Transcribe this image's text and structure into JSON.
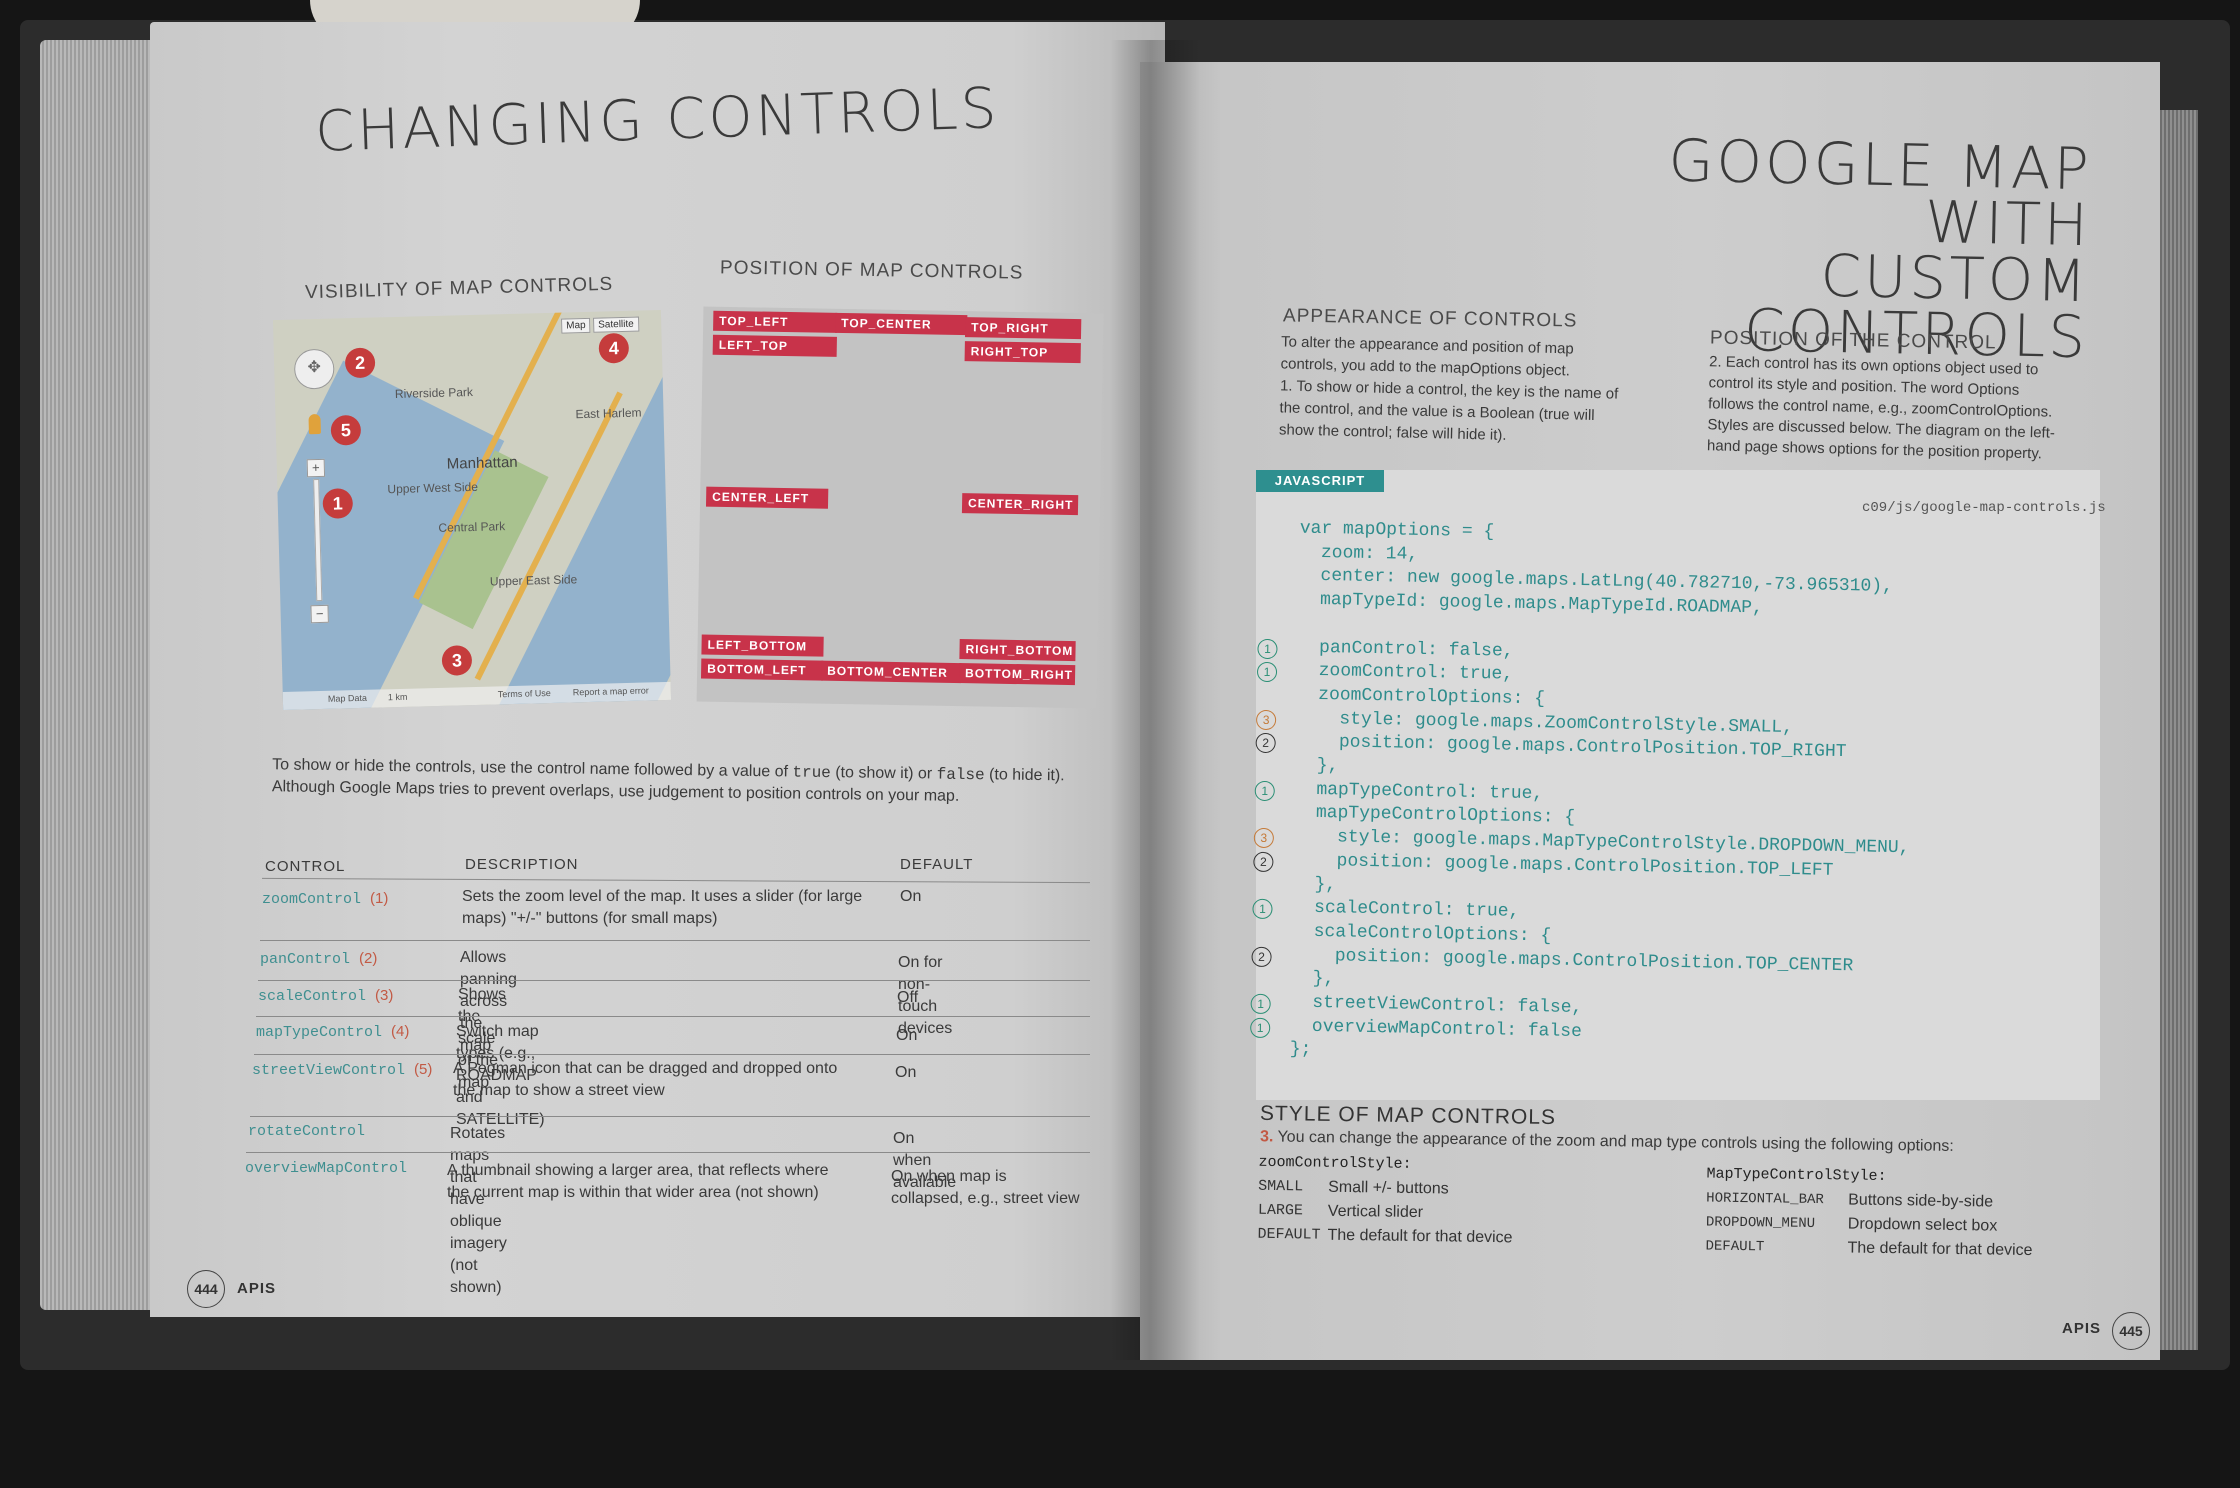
{
  "left_page": {
    "title": "CHANGING CONTROLS",
    "visibility_heading": "VISIBILITY OF MAP CONTROLS",
    "position_heading": "POSITION OF MAP CONTROLS",
    "map": {
      "type_buttons": [
        "Map",
        "Satellite"
      ],
      "place_labels": [
        "Manhattan",
        "Central Park",
        "Upper West Side",
        "Upper East Side",
        "Riverside Park",
        "East Harlem"
      ],
      "footer_labels": [
        "Map Data",
        "1 km",
        "Terms of Use",
        "Report a map error"
      ],
      "pins": [
        "1",
        "2",
        "3",
        "4",
        "5"
      ]
    },
    "positions": {
      "top_left": "TOP_LEFT",
      "top_center": "TOP_CENTER",
      "top_right": "TOP_RIGHT",
      "left_top": "LEFT_TOP",
      "right_top": "RIGHT_TOP",
      "center_left": "CENTER_LEFT",
      "center_right": "CENTER_RIGHT",
      "left_bottom": "LEFT_BOTTOM",
      "right_bottom": "RIGHT_BOTTOM",
      "bottom_left": "BOTTOM_LEFT",
      "bottom_center": "BOTTOM_CENTER",
      "bottom_right": "BOTTOM_RIGHT"
    },
    "intro": {
      "a": "To show or hide the controls, use the control name followed by a value of ",
      "true_kw": "true",
      "b": " (to show it) or ",
      "false_kw": "false",
      "c": " (to hide it).",
      "line2": "Although Google Maps tries to prevent overlaps, use judgement to position controls on your map."
    },
    "table": {
      "headers": [
        "CONTROL",
        "DESCRIPTION",
        "DEFAULT"
      ],
      "rows": [
        {
          "control": "zoomControl",
          "num": "(1)",
          "desc1": "Sets the zoom level of the map. It uses a slider (for large",
          "desc2": "maps) \"+/-\" buttons (for small maps)",
          "default1": "On",
          "default2": ""
        },
        {
          "control": "panControl",
          "num": "(2)",
          "desc1": "Allows panning across the map",
          "desc2": "",
          "default1": "On for non-touch devices",
          "default2": ""
        },
        {
          "control": "scaleControl",
          "num": "(3)",
          "desc1": "Shows the scale of the map",
          "desc2": "",
          "default1": "Off",
          "default2": ""
        },
        {
          "control": "mapTypeControl",
          "num": "(4)",
          "desc1": "Switch map types (e.g., ROADMAP and SATELLITE)",
          "desc2": "",
          "default1": "On",
          "default2": ""
        },
        {
          "control": "streetViewControl",
          "num": "(5)",
          "desc1": "A Pegman icon that can be dragged and dropped onto",
          "desc2": "the map to show a street view",
          "default1": "On",
          "default2": ""
        },
        {
          "control": "rotateControl",
          "num": "",
          "desc1": "Rotates maps that have oblique imagery (not shown)",
          "desc2": "",
          "default1": "On when available",
          "default2": ""
        },
        {
          "control": "overviewMapControl",
          "num": "",
          "desc1": "A thumbnail showing a larger area, that reflects where",
          "desc2": "the current map is within that wider area (not shown)",
          "default1": "On when map is",
          "default2": "collapsed, e.g., street view"
        }
      ]
    },
    "page_number": "444",
    "footer": "APIS"
  },
  "right_page": {
    "title_line1": "GOOGLE MAP WITH",
    "title_line2": "CUSTOM CONTROLS",
    "appearance_heading": "APPEARANCE OF CONTROLS",
    "appearance_text": [
      "To alter the appearance and position of map",
      "controls, you add to the mapOptions object.",
      "1. To show or hide a control, the key is the name of",
      "the control, and the value is a Boolean (true will",
      "show the control; false will hide it)."
    ],
    "position_heading": "POSITION OF THE CONTROL",
    "position_text": [
      "2. Each control has its own options object used to",
      "control its style and position. The word Options",
      "follows the control name, e.g., zoomControlOptions.",
      "Styles are discussed below. The  diagram on the left-",
      "hand page shows options for the position property."
    ],
    "js_label": "JAVASCRIPT",
    "file_path": "c09/js/google-map-controls.js",
    "code_lines": [
      {
        "text": "var mapOptions = {",
        "marker": ""
      },
      {
        "text": "  zoom: 14,",
        "marker": ""
      },
      {
        "text": "  center: new google.maps.LatLng(40.782710,-73.965310),",
        "marker": ""
      },
      {
        "text": "  mapTypeId: google.maps.MapTypeId.ROADMAP,",
        "marker": ""
      },
      {
        "text": "",
        "marker": ""
      },
      {
        "text": "  panControl: false,",
        "marker": "1"
      },
      {
        "text": "  zoomControl: true,",
        "marker": "1"
      },
      {
        "text": "  zoomControlOptions: {",
        "marker": ""
      },
      {
        "text": "    style: google.maps.ZoomControlStyle.SMALL,",
        "marker": "3"
      },
      {
        "text": "    position: google.maps.ControlPosition.TOP_RIGHT",
        "marker": "2"
      },
      {
        "text": "  },",
        "marker": ""
      },
      {
        "text": "  mapTypeControl: true,",
        "marker": "1"
      },
      {
        "text": "  mapTypeControlOptions: {",
        "marker": ""
      },
      {
        "text": "    style: google.maps.MapTypeControlStyle.DROPDOWN_MENU,",
        "marker": "3"
      },
      {
        "text": "    position: google.maps.ControlPosition.TOP_LEFT",
        "marker": "2"
      },
      {
        "text": "  },",
        "marker": ""
      },
      {
        "text": "  scaleControl: true,",
        "marker": "1"
      },
      {
        "text": "  scaleControlOptions: {",
        "marker": ""
      },
      {
        "text": "    position: google.maps.ControlPosition.TOP_CENTER",
        "marker": "2"
      },
      {
        "text": "  },",
        "marker": ""
      },
      {
        "text": "  streetViewControl: false,",
        "marker": "1"
      },
      {
        "text": "  overviewMapControl: false",
        "marker": "1"
      },
      {
        "text": "};",
        "marker": ""
      }
    ],
    "style_heading": "STYLE OF MAP CONTROLS",
    "style_intro_num": "3.",
    "style_intro": "You can change the appearance of the zoom and map type controls using the following options:",
    "zoom_style": {
      "heading": "zoomControlStyle:",
      "rows": [
        {
          "key": "SMALL",
          "value": "Small +/- buttons"
        },
        {
          "key": "LARGE",
          "value": "Vertical slider"
        },
        {
          "key": "DEFAULT",
          "value": "The default for that device"
        }
      ]
    },
    "maptype_style": {
      "heading": "MapTypeControlStyle:",
      "rows": [
        {
          "key": "HORIZONTAL_BAR",
          "value": "Buttons side-by-side"
        },
        {
          "key": "DROPDOWN_MENU",
          "value": "Dropdown select box"
        },
        {
          "key": "DEFAULT",
          "value": "The default for that device"
        }
      ]
    },
    "footer": "APIS",
    "page_number": "445"
  }
}
